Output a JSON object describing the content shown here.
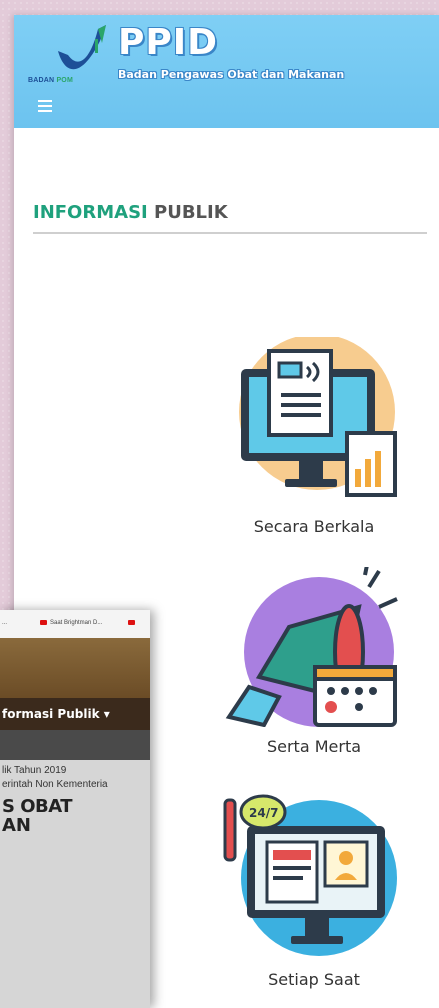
{
  "header": {
    "logo_text": "BADAN",
    "logo_text_accent": "POM",
    "title": "PPID",
    "subtitle": "Badan Pengawas Obat dan Makanan"
  },
  "section": {
    "title_accent": "INFORMASI",
    "title_rest": "PUBLIK"
  },
  "items": [
    {
      "label": "Secara Berkala",
      "icon": "announcement-monitor-icon"
    },
    {
      "label": "Serta Merta",
      "icon": "megaphone-calendar-icon"
    },
    {
      "label": "Setiap Saat",
      "icon": "24-7-support-monitor-icon"
    }
  ],
  "inset": {
    "tab1": "...",
    "tab2": "Saat Brightman D...",
    "nav_item": "formasi Publik ▾",
    "slide_line1": "lik Tahun 2019",
    "slide_line2": "erintah Non Kementeria",
    "slide_line3": "S OBAT",
    "slide_line4": "AN"
  },
  "colors": {
    "header_bg": "#7fcff5",
    "accent_green": "#1fa17d",
    "logo_blue": "#1d4f97"
  }
}
